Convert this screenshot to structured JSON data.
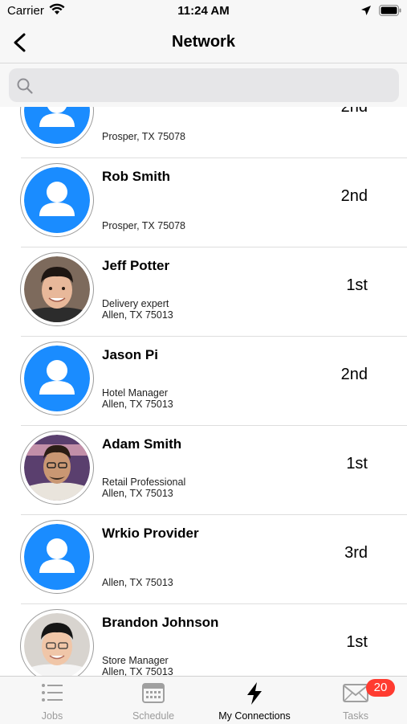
{
  "status_bar": {
    "carrier": "Carrier",
    "time": "11:24 AM"
  },
  "nav": {
    "title": "Network"
  },
  "search": {
    "placeholder": ""
  },
  "connections": [
    {
      "name": "",
      "title": "",
      "location": "Prosper, TX 75078",
      "degree": "2nd",
      "avatar": "placeholder-avatar-icon"
    },
    {
      "name": "Rob Smith",
      "title": "",
      "location": "Prosper, TX 75078",
      "degree": "2nd",
      "avatar": "placeholder-avatar-icon"
    },
    {
      "name": "Jeff Potter",
      "title": "Delivery expert",
      "location": "Allen, TX 75013",
      "degree": "1st",
      "avatar": "photo"
    },
    {
      "name": "Jason Pi",
      "title": "Hotel Manager",
      "location": "Allen, TX 75013",
      "degree": "2nd",
      "avatar": "placeholder-avatar-icon"
    },
    {
      "name": "Adam Smith",
      "title": "Retail Professional",
      "location": "Allen, TX 75013",
      "degree": "1st",
      "avatar": "photo"
    },
    {
      "name": "Wrkio Provider",
      "title": "",
      "location": "Allen, TX 75013",
      "degree": "3rd",
      "avatar": "placeholder-avatar-icon"
    },
    {
      "name": "Brandon Johnson",
      "title": "Store Manager",
      "location": "Allen, TX 75013",
      "degree": "1st",
      "avatar": "photo"
    }
  ],
  "tabs": [
    {
      "label": "Jobs",
      "icon": "list-icon"
    },
    {
      "label": "Schedule",
      "icon": "calendar-icon"
    },
    {
      "label": "My Connections",
      "icon": "lightning-icon"
    },
    {
      "label": "Tasks",
      "icon": "mail-icon",
      "badge": "20"
    }
  ],
  "colors": {
    "accent": "#1a8cff",
    "badge": "#ff3b30"
  }
}
